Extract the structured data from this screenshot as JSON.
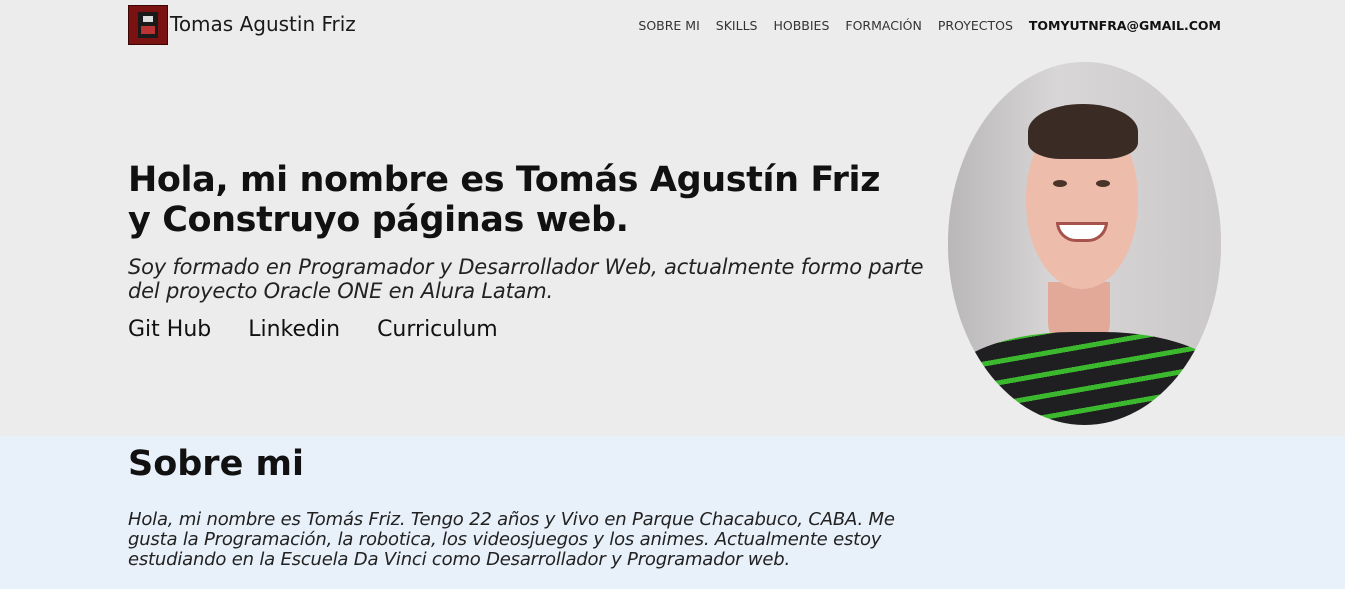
{
  "header": {
    "logo_icon": "shield-emblem-icon",
    "brand": "Tomas Agustin Friz",
    "nav": [
      "SOBRE MI",
      "SKILLS",
      "HOBBIES",
      "FORMACIÓN",
      "PROYECTOS"
    ],
    "email": "TOMYUTNFRA@GMAIL.COM"
  },
  "hero": {
    "title": "Hola, mi nombre es Tomás Agustín Friz y Construyo páginas web.",
    "subtitle": "Soy formado en Programador y Desarrollador Web, actualmente formo parte del proyecto Oracle ONE en Alura Latam.",
    "links": [
      "Git Hub",
      "Linkedin",
      "Curriculum"
    ]
  },
  "about": {
    "title": "Sobre mi",
    "text": "Hola, mi nombre es Tomás Friz. Tengo 22 años y Vivo en Parque Chacabuco, CABA. Me gusta la Programación, la robotica, los videosjuegos y los animes. Actualmente estoy estudiando en la Escuela Da Vinci como Desarrollador y Programador web."
  },
  "colors": {
    "hero_bg": "#ececec",
    "about_bg": "#e8f0fa",
    "logo_red": "#7a1212"
  }
}
